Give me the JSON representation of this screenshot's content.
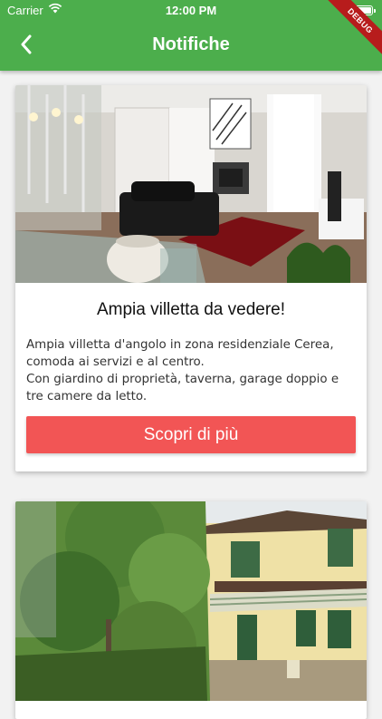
{
  "status_bar": {
    "carrier": "Carrier",
    "time": "12:00 PM"
  },
  "app_bar": {
    "title": "Notifiche",
    "back_icon": "chevron-left-icon"
  },
  "debug_banner": "DEBUG",
  "colors": {
    "app_bar": "#4cae4c",
    "cta": "#f25555",
    "background": "#f2f2f2"
  },
  "cards": [
    {
      "title": "Ampia villetta da vedere!",
      "description_lines": [
        "Ampia villetta d'angolo in zona residenziale Cerea,",
        "comoda ai servizi e al centro.",
        "Con giardino di proprietà, taverna, garage doppio e",
        "tre camere da letto."
      ],
      "button_label": "Scopri di più"
    },
    {
      "title": "",
      "description_lines": [],
      "button_label": ""
    }
  ]
}
